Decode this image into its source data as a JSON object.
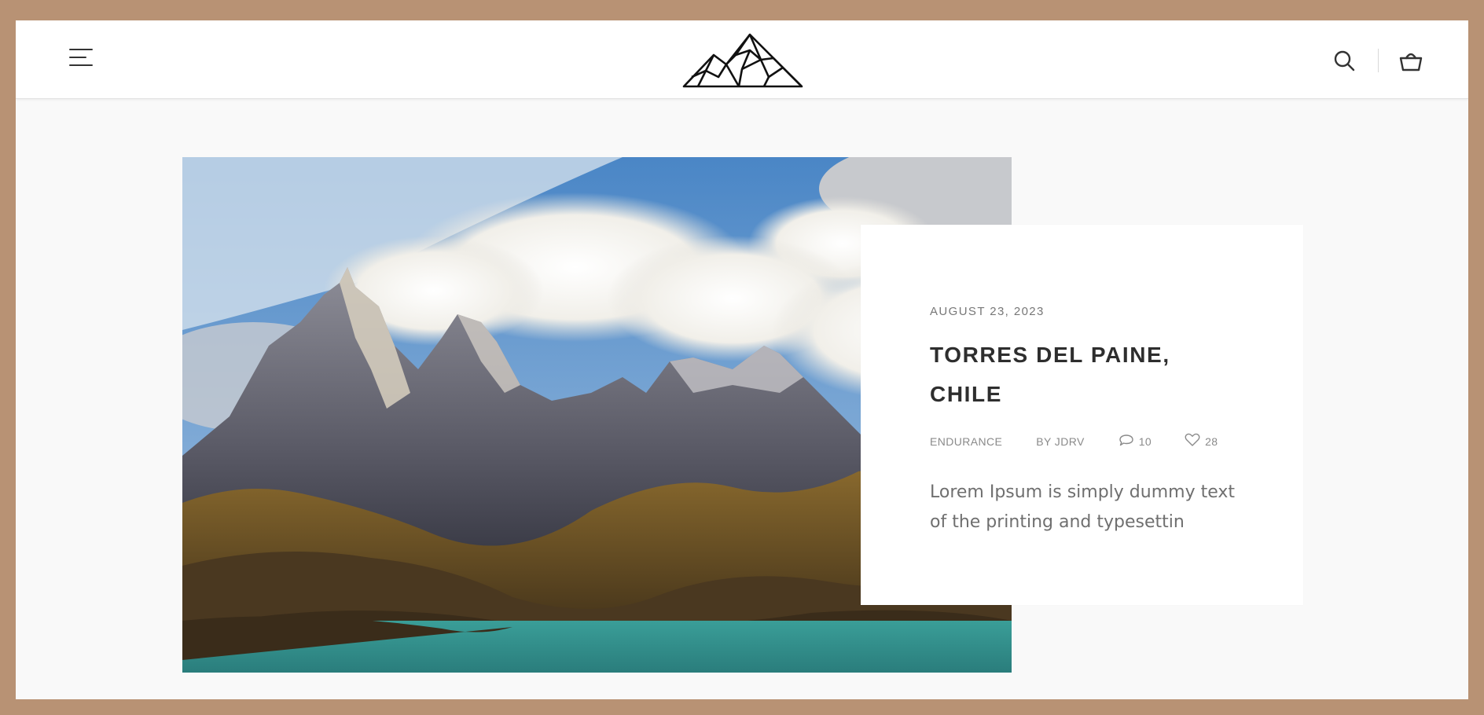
{
  "header": {
    "menu_icon": "hamburger-menu-icon",
    "logo_icon": "mountain-logo-icon",
    "search_icon": "search-icon",
    "cart_icon": "shopping-basket-icon"
  },
  "hero": {
    "image": "mountain-landscape-photo"
  },
  "post": {
    "date": "AUGUST 23, 2023",
    "title_line1": "TORRES DEL PAINE,",
    "title_line2": "CHILE",
    "category": "ENDURANCE",
    "author": "BY JDRV",
    "comments": "10",
    "likes": "28",
    "excerpt": "Lorem Ipsum is simply dummy text of the printing and typesettin"
  },
  "colors": {
    "frame": "#b89274",
    "page_bg": "#f9f9f9",
    "title": "#2e2e2e",
    "meta": "#8a8a8a"
  }
}
